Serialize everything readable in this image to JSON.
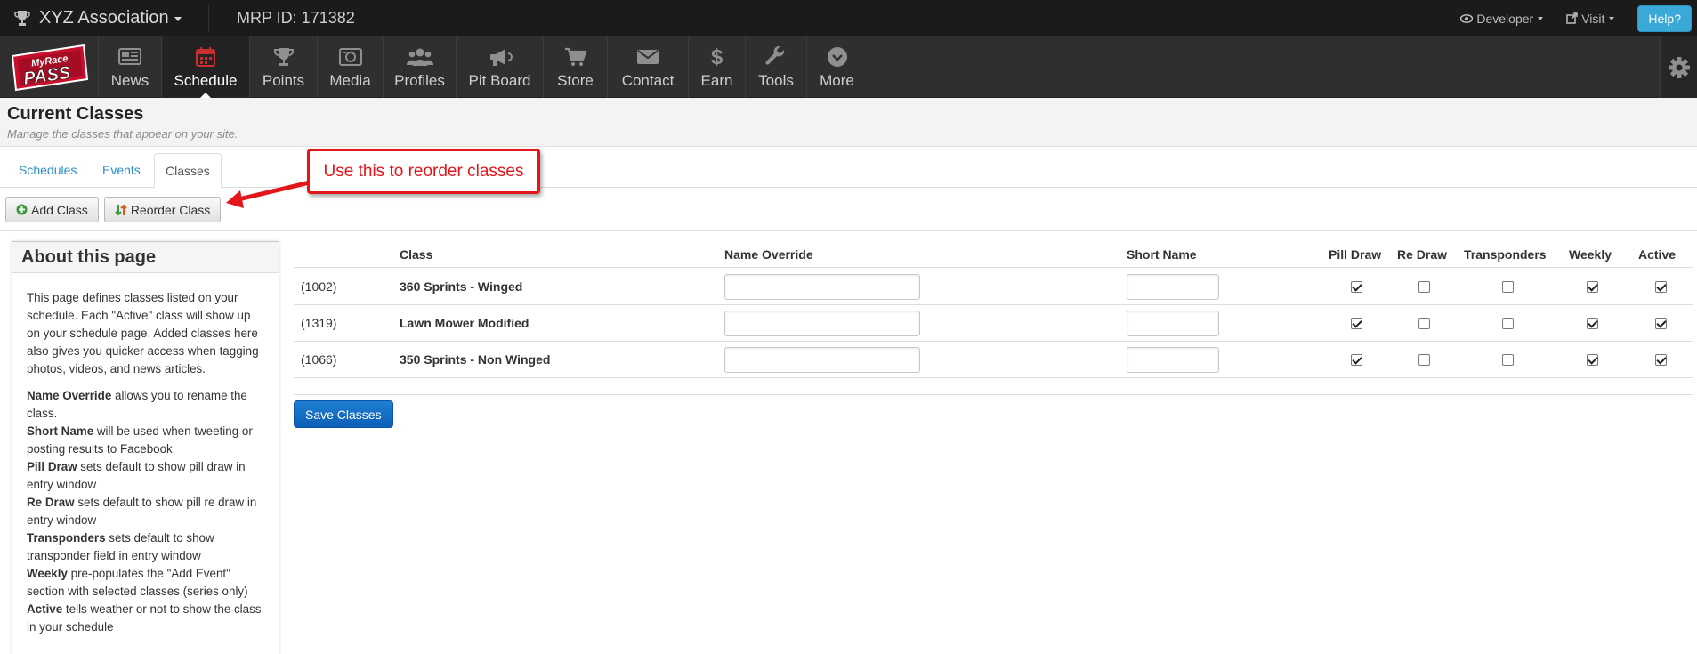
{
  "topbar": {
    "org_name": "XYZ Association",
    "mrp_id": "MRP ID: 171382",
    "developer_label": "Developer",
    "visit_label": "Visit",
    "help_label": "Help?"
  },
  "logo": {
    "text_top": "MyRace",
    "text_bottom": "PASS"
  },
  "nav": {
    "items": [
      {
        "label": "News",
        "icon": "newspaper-icon"
      },
      {
        "label": "Schedule",
        "icon": "calendar-icon"
      },
      {
        "label": "Points",
        "icon": "trophy-icon"
      },
      {
        "label": "Media",
        "icon": "photo-icon"
      },
      {
        "label": "Profiles",
        "icon": "group-icon"
      },
      {
        "label": "Pit Board",
        "icon": "bullhorn-icon"
      },
      {
        "label": "Store",
        "icon": "cart-icon"
      },
      {
        "label": "Contact",
        "icon": "envelope-icon"
      },
      {
        "label": "Earn",
        "icon": "dollar-icon"
      },
      {
        "label": "Tools",
        "icon": "wrench-icon"
      },
      {
        "label": "More",
        "icon": "chevron-circle-icon"
      }
    ],
    "active": "Schedule"
  },
  "page": {
    "title": "Current Classes",
    "subtitle": "Manage the classes that appear on your site."
  },
  "tabs": [
    {
      "label": "Schedules"
    },
    {
      "label": "Events"
    },
    {
      "label": "Classes"
    }
  ],
  "toolbar": {
    "add_label": "Add Class",
    "reorder_label": "Reorder Class"
  },
  "callout": {
    "text": "Use this to reorder classes"
  },
  "about": {
    "title": "About this page",
    "intro": "This page defines classes listed on your schedule. Each \"Active\" class will show up on your schedule page. Added classes here also gives you quicker access when tagging photos, videos, and news articles.",
    "definitions": [
      {
        "term": "Name Override",
        "text": " allows you to rename the class."
      },
      {
        "term": "Short Name",
        "text": " will be used when tweeting or posting results to Facebook"
      },
      {
        "term": "Pill Draw",
        "text": " sets default to show pill draw in entry window"
      },
      {
        "term": "Re Draw",
        "text": " sets default to show pill re draw in entry window"
      },
      {
        "term": "Transponders",
        "text": " sets default to show transponder field in entry window"
      },
      {
        "term": "Weekly",
        "text": " pre-populates the \"Add Event\" section with selected classes (series only)"
      },
      {
        "term": "Active",
        "text": " tells weather or not to show the class in your schedule"
      }
    ]
  },
  "table": {
    "headers": [
      "Class",
      "Name Override",
      "Short Name",
      "Pill Draw",
      "Re Draw",
      "Transponders",
      "Weekly",
      "Active"
    ],
    "rows": [
      {
        "id": "(1002)",
        "name": "360 Sprints - Winged",
        "name_override": "",
        "short_name": "",
        "pill_draw": true,
        "re_draw": false,
        "transponders": false,
        "weekly": true,
        "active": true
      },
      {
        "id": "(1319)",
        "name": "Lawn Mower Modified",
        "name_override": "",
        "short_name": "",
        "pill_draw": true,
        "re_draw": false,
        "transponders": false,
        "weekly": true,
        "active": true
      },
      {
        "id": "(1066)",
        "name": "350 Sprints - Non Winged",
        "name_override": "",
        "short_name": "",
        "pill_draw": true,
        "re_draw": false,
        "transponders": false,
        "weekly": true,
        "active": true
      }
    ],
    "save_label": "Save Classes"
  },
  "colors": {
    "topbar_bg": "#1b1b1b",
    "nav_bg": "#2f2f2f",
    "link": "#2a8fc7",
    "help": "#3aa9d8",
    "callout_red": "#e3161b",
    "save_blue": "#0b5fb7"
  }
}
